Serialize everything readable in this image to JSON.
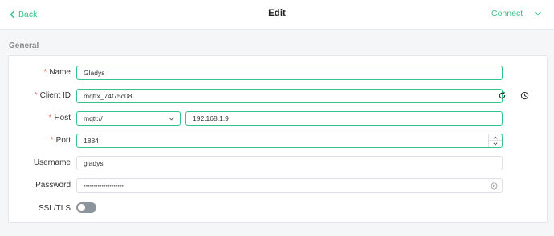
{
  "header": {
    "back_label": "Back",
    "title": "Edit",
    "connect_label": "Connect"
  },
  "section": {
    "label": "General"
  },
  "form": {
    "name": {
      "label": "Name",
      "required": true,
      "value": "Gladys"
    },
    "client_id": {
      "label": "Client ID",
      "required": true,
      "value": "mqttx_74f75c08"
    },
    "host": {
      "label": "Host",
      "required": true,
      "protocol": "mqtt://",
      "value": "192.168.1.9"
    },
    "port": {
      "label": "Port",
      "required": true,
      "value": "1884"
    },
    "username": {
      "label": "Username",
      "value": "gladys"
    },
    "password": {
      "label": "Password",
      "masked_value": "••••••••••••••••••••"
    },
    "ssl": {
      "label": "SSL/TLS",
      "enabled": false
    }
  },
  "colors": {
    "accent": "#34c388",
    "required": "#f56c6c",
    "toggle_off": "#8e949b"
  },
  "icons": [
    "chevron-left-icon",
    "chevron-down-icon",
    "refresh-icon",
    "clock-icon",
    "spinner-up-icon",
    "spinner-down-icon",
    "clear-icon"
  ]
}
